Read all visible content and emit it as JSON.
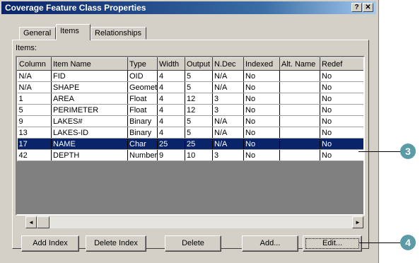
{
  "window": {
    "title": "Coverage Feature Class Properties",
    "help_glyph": "?",
    "close_glyph": "✕"
  },
  "tabs": [
    {
      "label": "General",
      "active": false
    },
    {
      "label": "Items",
      "active": true
    },
    {
      "label": "Relationships",
      "active": false
    }
  ],
  "items_label": "Items:",
  "table": {
    "headers": [
      "Column",
      "Item Name",
      "Type",
      "Width",
      "Output",
      "N.Dec",
      "Indexed",
      "Alt. Name",
      "Redef"
    ],
    "rows": [
      [
        "N/A",
        "FID",
        "OID",
        "4",
        "5",
        "N/A",
        "No",
        "",
        "No"
      ],
      [
        "N/A",
        "SHAPE",
        "Geometry",
        "4",
        "5",
        "N/A",
        "No",
        "",
        "No"
      ],
      [
        "1",
        "AREA",
        "Float",
        "4",
        "12",
        "3",
        "No",
        "",
        "No"
      ],
      [
        "5",
        "PERIMETER",
        "Float",
        "4",
        "12",
        "3",
        "No",
        "",
        "No"
      ],
      [
        "9",
        "LAKES#",
        "Binary",
        "4",
        "5",
        "N/A",
        "No",
        "",
        "No"
      ],
      [
        "13",
        "LAKES-ID",
        "Binary",
        "4",
        "5",
        "N/A",
        "No",
        "",
        "No"
      ],
      [
        "17",
        "NAME",
        "Char",
        "25",
        "25",
        "N/A",
        "No",
        "",
        "No"
      ],
      [
        "42",
        "DEPTH",
        "Number",
        "9",
        "10",
        "3",
        "No",
        "",
        "No"
      ]
    ],
    "selected_row": 6
  },
  "scroll": {
    "left_icon": "◄",
    "right_icon": "►"
  },
  "buttons": {
    "add_index": "Add Index",
    "delete_index": "Delete Index",
    "delete": "Delete",
    "add": "Add...",
    "edit": "Edit..."
  },
  "callouts": [
    {
      "label": "3"
    },
    {
      "label": "4"
    }
  ],
  "colors": {
    "selection": "#0a246a",
    "callout": "#5b9aa7",
    "dialog": "#d4d0c8"
  }
}
